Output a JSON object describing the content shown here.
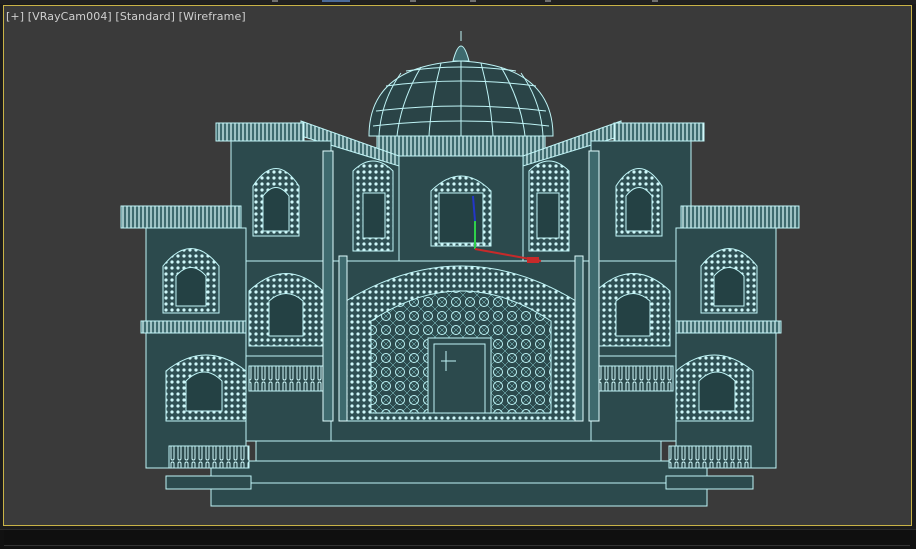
{
  "viewport": {
    "label_parts": [
      "[+]",
      "[VRayCam004]",
      "[Standard]",
      "[Wireframe]"
    ],
    "background_color": "#3a3a3a",
    "border_color": "#c9b347",
    "wire_color": "#bff4f6",
    "shade_color": "#2c4a4d"
  },
  "gizmo": {
    "axis_colors": {
      "x": "#c62a2a",
      "y": "#2fd04a",
      "z": "#2336c8"
    }
  }
}
